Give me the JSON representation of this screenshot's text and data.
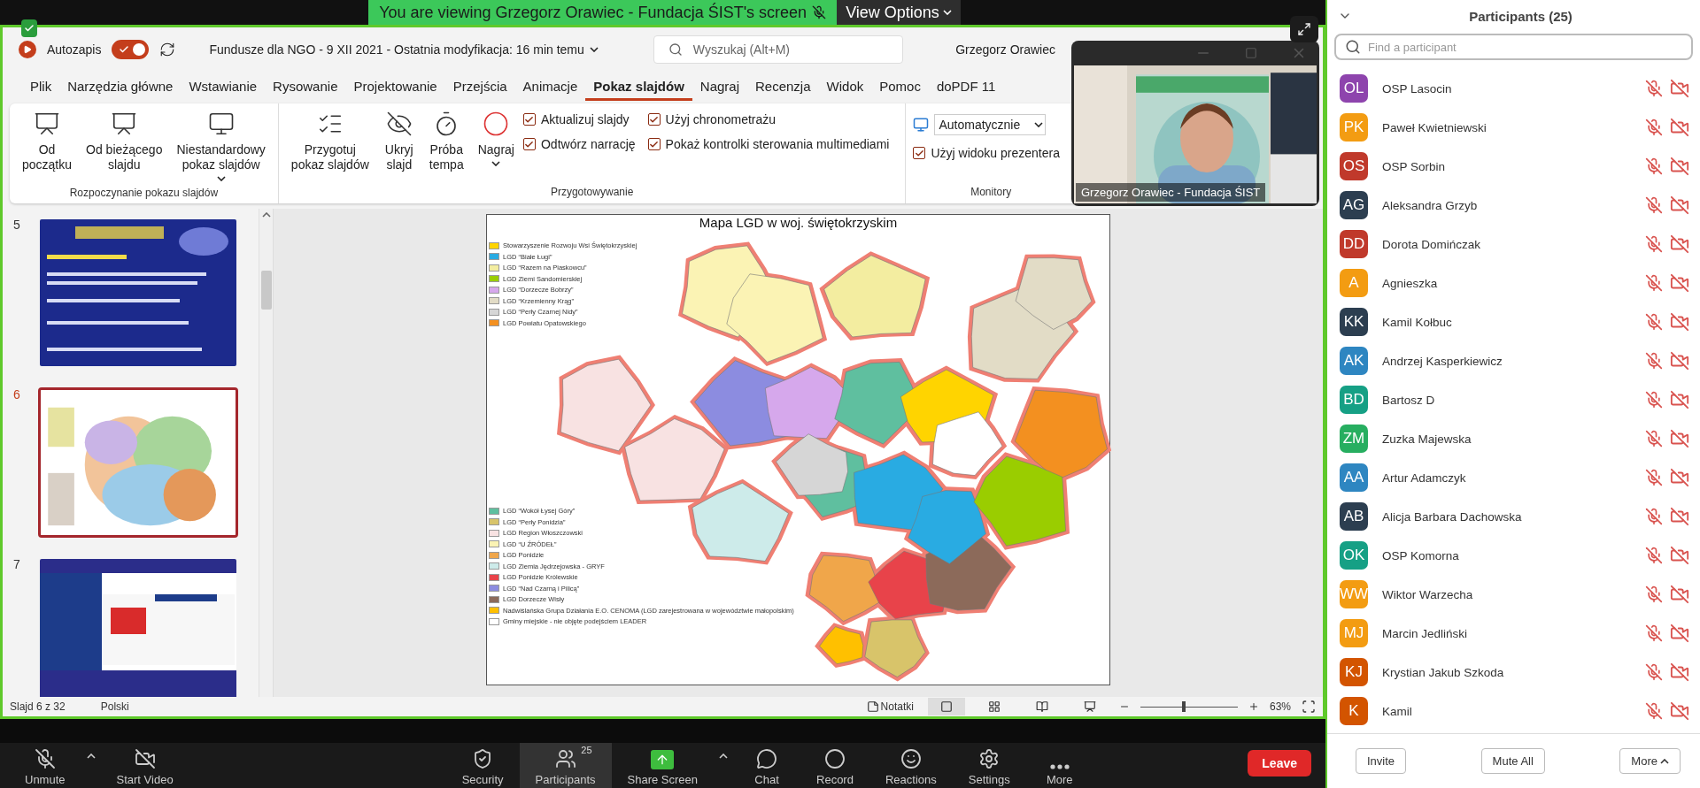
{
  "share_banner": {
    "text": "You are viewing Grzegorz Orawiec - Fundacja ŚIST's screen",
    "view_options": "View Options"
  },
  "powerpoint": {
    "autosave_label": "Autozapis",
    "autosave_on": true,
    "document_title": "Fundusze dla NGO - 9 XII 2021  -  Ostatnia modyfikacja: 16 min temu",
    "search": {
      "placeholder": "Wyszukaj (Alt+M)"
    },
    "user": "Grzegorz Orawiec",
    "tabs": [
      {
        "label": "Plik",
        "selected": false
      },
      {
        "label": "Narzędzia główne",
        "selected": false
      },
      {
        "label": "Wstawianie",
        "selected": false
      },
      {
        "label": "Rysowanie",
        "selected": false
      },
      {
        "label": "Projektowanie",
        "selected": false
      },
      {
        "label": "Przejścia",
        "selected": false
      },
      {
        "label": "Animacje",
        "selected": false
      },
      {
        "label": "Pokaz slajdów",
        "selected": true
      },
      {
        "label": "Nagraj",
        "selected": false
      },
      {
        "label": "Recenzja",
        "selected": false
      },
      {
        "label": "Widok",
        "selected": false
      },
      {
        "label": "Pomoc",
        "selected": false
      },
      {
        "label": "doPDF 11",
        "selected": false
      }
    ],
    "ribbon_groups": [
      {
        "label": "Rozpoczynanie pokazu slajdów",
        "buttons": [
          {
            "label": "Od\npoczątku",
            "dropdown": false
          },
          {
            "label": "Od bieżącego\nslajdu",
            "dropdown": false
          },
          {
            "label": "Niestandardowy\npokaz slajdów",
            "dropdown": true
          }
        ]
      },
      {
        "label": "Przygotowywanie",
        "buttons": [
          {
            "label": "Przygotuj\npokaz slajdów",
            "dropdown": false
          },
          {
            "label": "Ukryj\nslajd",
            "dropdown": false
          },
          {
            "label": "Próba\ntempa",
            "dropdown": false
          },
          {
            "label": "Nagraj",
            "dropdown": true
          }
        ],
        "checkbox_columns": [
          [
            {
              "label": "Aktualizuj slajdy",
              "checked": true
            },
            {
              "label": "Odtwórz narrację",
              "checked": true
            }
          ],
          [
            {
              "label": "Użyj chronometrażu",
              "checked": true
            },
            {
              "label": "Pokaż kontrolki sterowania multimediami",
              "checked": true
            }
          ]
        ]
      },
      {
        "label": "Monitory",
        "select": {
          "value": "Automatycznie"
        },
        "checkbox_columns": [
          [
            {
              "label": "Użyj widoku prezentera",
              "checked": true
            }
          ]
        ]
      }
    ],
    "slides": [
      {
        "number": "5",
        "kind": "program",
        "selected": false
      },
      {
        "number": "6",
        "kind": "map",
        "selected": true
      },
      {
        "number": "7",
        "kind": "offer",
        "selected": false
      }
    ],
    "slide": {
      "title": "Mapa LGD w woj. świętokrzyskim",
      "legend_top": [
        {
          "label": "Stowarzyszenie Rozwoju Wsi Świętokrzyskiej",
          "color": "#ffd400"
        },
        {
          "label": "LGD “Białe Ługi”",
          "color": "#29abe2"
        },
        {
          "label": "LGD “Razem na Piaskowcu”",
          "color": "#f3eda0"
        },
        {
          "label": "LGD Ziemi Sandomierskiej",
          "color": "#9acd00"
        },
        {
          "label": "LGD “Dorzecze Bobrzy”",
          "color": "#d6a8ec"
        },
        {
          "label": "LGD “Krzemienny Krąg”",
          "color": "#e2dcc6"
        },
        {
          "label": "LGD “Perły Czarnej Nidy”",
          "color": "#d6d6d6"
        },
        {
          "label": "LGD Powiatu Opatowskiego",
          "color": "#f39020"
        }
      ],
      "legend_bottom": [
        {
          "label": "LGD “Wokół Łysej Góry”",
          "color": "#5fbf9f"
        },
        {
          "label": "LGD “Perły Ponidzia”",
          "color": "#d8c46a"
        },
        {
          "label": "LGD Region Włoszczowski",
          "color": "#f8e2e2"
        },
        {
          "label": "LGD “U ŹRÓDEŁ”",
          "color": "#fbf3b4"
        },
        {
          "label": "LGD Ponidzie",
          "color": "#f0a64a"
        },
        {
          "label": "LGD Ziemia Jędrzejowska - GRYF",
          "color": "#cdebea"
        },
        {
          "label": "LGD Ponidzie Królewskie",
          "color": "#e8434a"
        },
        {
          "label": "LGD “Nad Czarną i Pilicą”",
          "color": "#8c8ce0"
        },
        {
          "label": "LGD Dorzecze Wisły",
          "color": "#8c6a5a"
        },
        {
          "label": "Nadwiślańska Grupa Działania E.O. CENOMA (LGD zarejestrowana w województwie małopolskim)",
          "color": "#ffc000"
        },
        {
          "label": "Gminy miejskie - nie objęte podejściem LEADER",
          "color": "#ffffff"
        }
      ]
    },
    "status_bar": {
      "slide_position": "Slajd 6 z 32",
      "language": "Polski",
      "notes": "Notatki",
      "views": [
        {
          "kind": "normal",
          "selected": true
        },
        {
          "kind": "sorter",
          "selected": false
        },
        {
          "kind": "reading",
          "selected": false
        },
        {
          "kind": "slideshow",
          "selected": false
        }
      ],
      "zoom": {
        "level": 0.45,
        "value": "63%"
      }
    }
  },
  "video": {
    "name": "Grzegorz Orawiec - Fundacja ŚIST"
  },
  "meeting_toolbar": {
    "left": [
      {
        "label": "Unmute",
        "caret": true,
        "selected": false
      },
      {
        "label": "Start Video",
        "caret": false,
        "selected": false
      }
    ],
    "center": [
      {
        "label": "Security",
        "caret": false,
        "selected": false
      },
      {
        "label": "Participants",
        "badge": "25",
        "caret": false,
        "selected": true
      },
      {
        "label": "Share Screen",
        "caret": true,
        "selected": false
      },
      {
        "label": "Chat",
        "caret": false,
        "selected": false
      },
      {
        "label": "Record",
        "caret": false,
        "selected": false
      },
      {
        "label": "Reactions",
        "caret": false,
        "selected": false
      },
      {
        "label": "Settings",
        "caret": false,
        "selected": false
      },
      {
        "label": "More",
        "caret": false,
        "selected": false
      }
    ],
    "leave": "Leave"
  },
  "participants": {
    "title": "Participants (25)",
    "search": {
      "placeholder": "Find a participant"
    },
    "list": [
      {
        "initials": "OL",
        "name": "OSP Lasocin",
        "color": "#8e44ad",
        "muted": true,
        "video_off": true
      },
      {
        "initials": "PK",
        "name": "Paweł Kwietniewski",
        "color": "#f39c12",
        "muted": true,
        "video_off": true
      },
      {
        "initials": "OS",
        "name": "OSP Sorbin",
        "color": "#c0392b",
        "muted": true,
        "video_off": true
      },
      {
        "initials": "AG",
        "name": "Aleksandra Grzyb",
        "color": "#2c3e50",
        "muted": true,
        "video_off": true
      },
      {
        "initials": "DD",
        "name": "Dorota Domińczak",
        "color": "#c0392b",
        "muted": true,
        "video_off": true
      },
      {
        "initials": "A",
        "name": "Agnieszka",
        "color": "#f39c12",
        "muted": true,
        "video_off": true
      },
      {
        "initials": "KK",
        "name": "Kamil Kołbuc",
        "color": "#2c3e50",
        "muted": true,
        "video_off": true
      },
      {
        "initials": "AK",
        "name": "Andrzej Kasperkiewicz",
        "color": "#2e86c1",
        "muted": true,
        "video_off": true
      },
      {
        "initials": "BD",
        "name": "Bartosz D",
        "color": "#16a085",
        "muted": true,
        "video_off": true
      },
      {
        "initials": "ZM",
        "name": "Zuzka Majewska",
        "color": "#27ae60",
        "muted": true,
        "video_off": true
      },
      {
        "initials": "AA",
        "name": "Artur Adamczyk",
        "color": "#2e86c1",
        "muted": true,
        "video_off": true
      },
      {
        "initials": "AB",
        "name": "Alicja Barbara Dachowska",
        "color": "#2c3e50",
        "muted": true,
        "video_off": true
      },
      {
        "initials": "OK",
        "name": "OSP Komorna",
        "color": "#16a085",
        "muted": true,
        "video_off": true
      },
      {
        "initials": "WW",
        "name": "Wiktor Warzecha",
        "color": "#f39c12",
        "muted": true,
        "video_off": true
      },
      {
        "initials": "MJ",
        "name": "Marcin Jedliński",
        "color": "#f39c12",
        "muted": true,
        "video_off": true
      },
      {
        "initials": "KJ",
        "name": "Krystian Jakub Szkoda",
        "color": "#d35400",
        "muted": true,
        "video_off": true
      },
      {
        "initials": "K",
        "name": "Kamil",
        "color": "#d35400",
        "muted": true,
        "video_off": true
      }
    ],
    "buttons": [
      {
        "label": "Invite",
        "caret": false
      },
      {
        "label": "Mute All",
        "caret": false
      },
      {
        "label": "More",
        "caret": true
      }
    ]
  }
}
